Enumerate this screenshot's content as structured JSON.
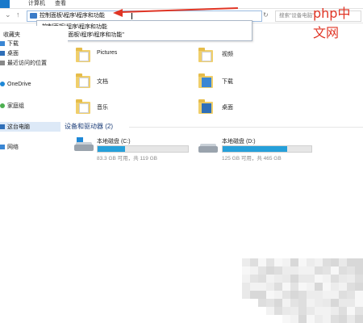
{
  "ribbon": {
    "tabs": [
      "计算机",
      "查看"
    ]
  },
  "address": {
    "path": "控制面板\\程序\\程序和功能"
  },
  "search": {
    "placeholder": "搜索\"设备电脑\""
  },
  "dropdown": {
    "items": [
      "控制面板\\程序\\程序和功能",
      "搜索 \"控制面板\\程序\\程序和功能\""
    ]
  },
  "sidebar": {
    "items": [
      "收藏夹",
      "下载",
      "桌面",
      "最近访问的位置",
      "OneDrive",
      "家庭组",
      "这台电脑",
      "网络"
    ]
  },
  "folders": [
    {
      "label": "Pictures",
      "icon": "pictures-folder-icon"
    },
    {
      "label": "视频",
      "icon": "videos-folder-icon"
    },
    {
      "label": "文档",
      "icon": "documents-folder-icon"
    },
    {
      "label": "下载",
      "icon": "downloads-folder-icon"
    },
    {
      "label": "音乐",
      "icon": "music-folder-icon"
    },
    {
      "label": "桌面",
      "icon": "desktop-folder-icon"
    }
  ],
  "devices": {
    "header": "设备和驱动器 (2)",
    "drives": [
      {
        "name": "本地磁盘 (C:)",
        "free": "83.3 GB 可用，共 119 GB",
        "used_fraction": 0.3
      },
      {
        "name": "本地磁盘 (D:)",
        "free": "125 GB 可用，共 465 GB",
        "used_fraction": 0.73
      }
    ]
  },
  "watermark": "php中文网",
  "colors": {
    "accent": "#26a0da",
    "annotation": "#e03525",
    "selection": "#dde9f7"
  }
}
